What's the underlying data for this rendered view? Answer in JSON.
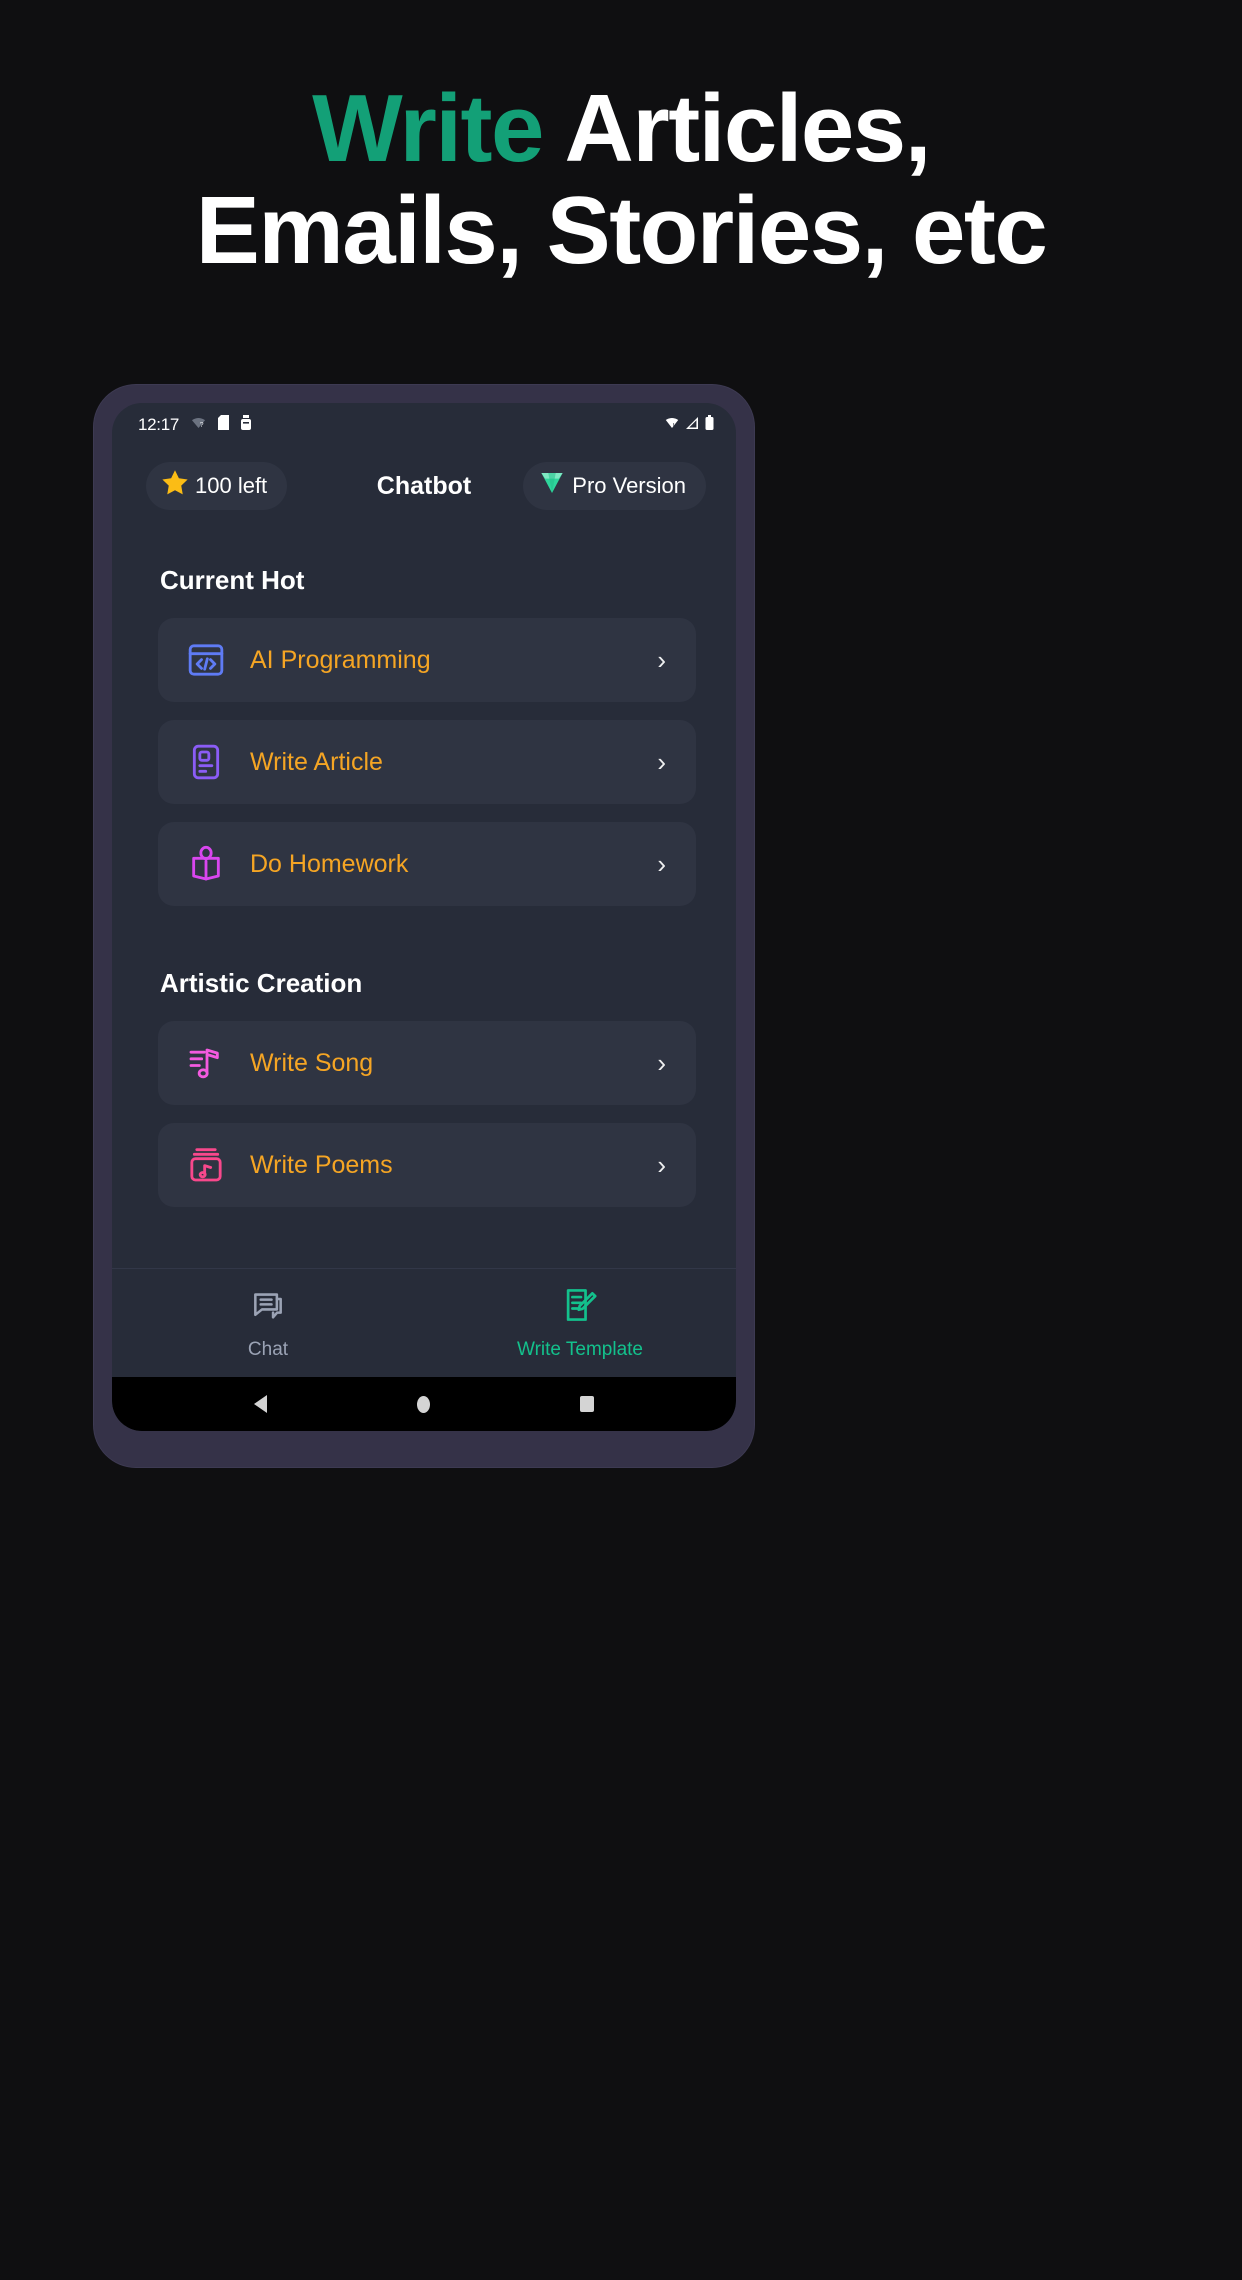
{
  "promo": {
    "headline_line1_accent": "Write",
    "headline_line1_rest": " Articles,",
    "headline_line2": "Emails, Stories, etc",
    "accent_color": "#13a077",
    "background_color": "#0f0f11"
  },
  "phone": {
    "status_bar": {
      "time": "12:17",
      "left_icons": [
        "wifi-question-icon",
        "sdcard-icon",
        "usb-icon"
      ],
      "right_icons": [
        "wifi-icon",
        "signal-icon",
        "battery-icon"
      ]
    },
    "header": {
      "credits_icon": "star-icon",
      "credits_label": "100 left",
      "title": "Chatbot",
      "pro_icon": "diamond-icon",
      "pro_label": "Pro Version"
    },
    "sections": [
      {
        "title": "Current Hot",
        "items": [
          {
            "label": "AI Programming",
            "icon": "code-window-icon",
            "icon_color": "#5f7bf5",
            "chevron": "›"
          },
          {
            "label": "Write Article",
            "icon": "article-icon",
            "icon_color": "#8b5cf6",
            "chevron": "›"
          },
          {
            "label": "Do Homework",
            "icon": "open-book-icon",
            "icon_color": "#d946ef",
            "chevron": "›"
          }
        ]
      },
      {
        "title": "Artistic Creation",
        "items": [
          {
            "label": "Write Song",
            "icon": "music-note-icon",
            "icon_color": "#f45ae0",
            "chevron": "›"
          },
          {
            "label": "Write Poems",
            "icon": "music-album-icon",
            "icon_color": "#f8488c",
            "chevron": "›"
          }
        ]
      }
    ],
    "bottom_nav": [
      {
        "label": "Chat",
        "icon": "chat-bubble-icon",
        "active": false,
        "color": "#9ba3b5"
      },
      {
        "label": "Write Template",
        "icon": "write-template-icon",
        "active": true,
        "color": "#13c18c"
      }
    ],
    "android_nav": [
      "back-icon",
      "home-icon",
      "recents-icon"
    ],
    "colors": {
      "screen_bg": "#272c39",
      "card_bg": "#2f3442",
      "frame": "#353248",
      "label": "#f5a524"
    }
  }
}
